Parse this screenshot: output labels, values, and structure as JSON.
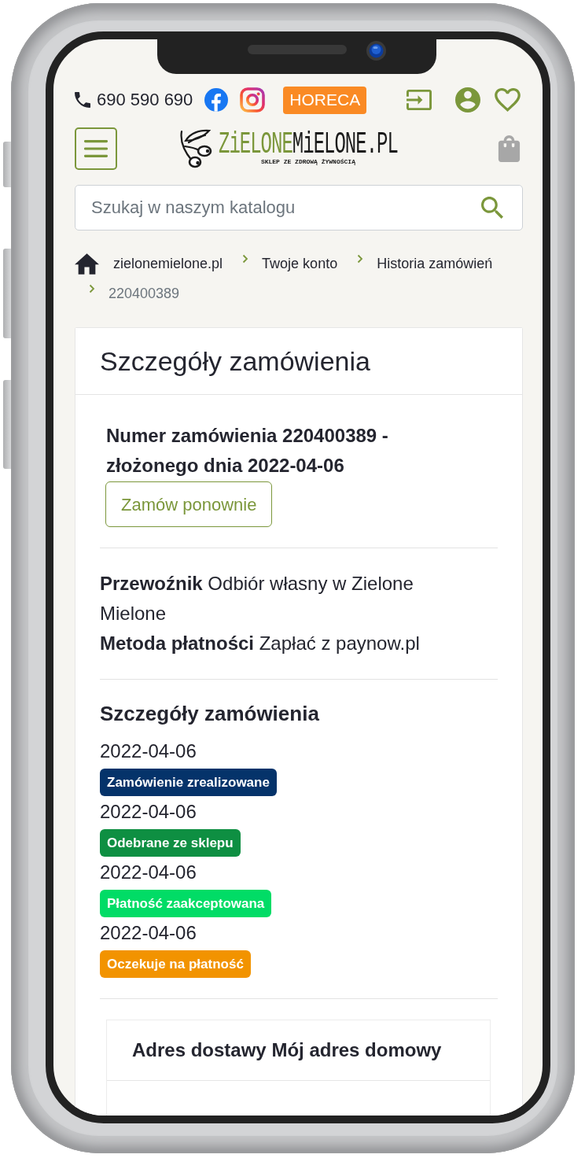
{
  "top_bar": {
    "phone": "690 590 690",
    "horeca_button": "HORECA"
  },
  "logo": {
    "wordmark_parts": [
      "ZiELONE",
      "MiELONE.PL"
    ],
    "tagline": "SKLEP ZE ZDROWĄ ŻYWNOŚCIĄ"
  },
  "search": {
    "placeholder": "Szukaj w naszym katalogu"
  },
  "breadcrumb": [
    {
      "label": "zielonemielone.pl",
      "kind": "home",
      "current": false
    },
    {
      "label": "Twoje konto",
      "kind": "page",
      "current": false
    },
    {
      "label": "Historia zamówień",
      "kind": "page",
      "current": false
    },
    {
      "label": "220400389",
      "kind": "page",
      "current": true
    }
  ],
  "order_card": {
    "title": "Szczegóły zamówienia",
    "order_heading": "Numer zamówienia 220400389 - złożonego dnia 2022-04-06",
    "reorder_button": "Zamów ponownie",
    "info": [
      {
        "label": "Przewoźnik",
        "value": "Odbiór własny w Zielone Mielone"
      },
      {
        "label": "Metoda płatności",
        "value": "Zapłać z paynow.pl"
      }
    ],
    "history_title": "Szczegóły zamówienia",
    "history": [
      {
        "date": "2022-04-06",
        "status": "Zamówienie zrealizowane",
        "color": "#05336a"
      },
      {
        "date": "2022-04-06",
        "status": "Odebrane ze sklepu",
        "color": "#0e8f42"
      },
      {
        "date": "2022-04-06",
        "status": "Płatność zaakceptowana",
        "color": "#01dc66"
      },
      {
        "date": "2022-04-06",
        "status": "Oczekuje na płatność",
        "color": "#f29300"
      }
    ],
    "address_card": {
      "title": "Adres dostawy Mój adres domowy"
    }
  }
}
